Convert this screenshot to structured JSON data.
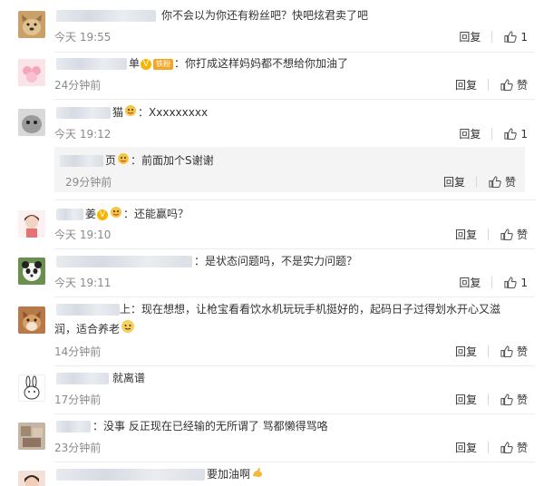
{
  "comments": [
    {
      "text": "你不会以为你还有粉丝吧？快吧炫君卖了吧",
      "time": "今天 19:55",
      "reply": "回复",
      "like": "1"
    },
    {
      "name_tail": "单",
      "fan_tag": "铁粉",
      "text": "：你打成这样妈妈都不想给你加油了",
      "time": "24分钟前",
      "reply": "回复",
      "like": "赞"
    },
    {
      "name_tail": "猫",
      "text": "：Xxxxxxxxx",
      "time": "今天 19:12",
      "reply": "回复",
      "like": "1"
    },
    {
      "name_tail": "：前面加个S谢谢",
      "time": "29分钟前",
      "reply": "回复",
      "like": "赞",
      "name_prefix": "页"
    },
    {
      "name_tail": "姜",
      "text": "：还能赢吗？",
      "time": "今天 19:10",
      "reply": "回复",
      "like": "赞"
    },
    {
      "text": "：是状态问题吗，不是实力问题？",
      "time": "今天 19:11",
      "reply": "回复",
      "like": "1"
    },
    {
      "name_tail": "上",
      "text_line1": "：现在想想，让枪宝看看饮水机玩玩手机挺好的，起码日子过得划水开心又滋",
      "text_line2": "润，适合养老",
      "time": "14分钟前",
      "reply": "回复",
      "like": "赞"
    },
    {
      "text": "就离谱",
      "time": "17分钟前",
      "reply": "回复",
      "like": "赞"
    },
    {
      "text": "：没事 反正现在已经输的无所谓了 骂都懒得骂咯",
      "time": "23分钟前",
      "reply": "回复",
      "like": "赞"
    },
    {
      "text": "要加油啊",
      "time": "",
      "reply": "",
      "like": ""
    }
  ],
  "colors": {
    "time": "#8a8a8a",
    "divider": "#ececec",
    "subbox": "#f4f4f4",
    "badge": "#f7b500"
  },
  "icons": {
    "like": "thumbs-up-icon",
    "vip": "v-badge-icon",
    "emoji": "doge-emoji-icon",
    "muscle": "muscle-emoji-icon"
  }
}
